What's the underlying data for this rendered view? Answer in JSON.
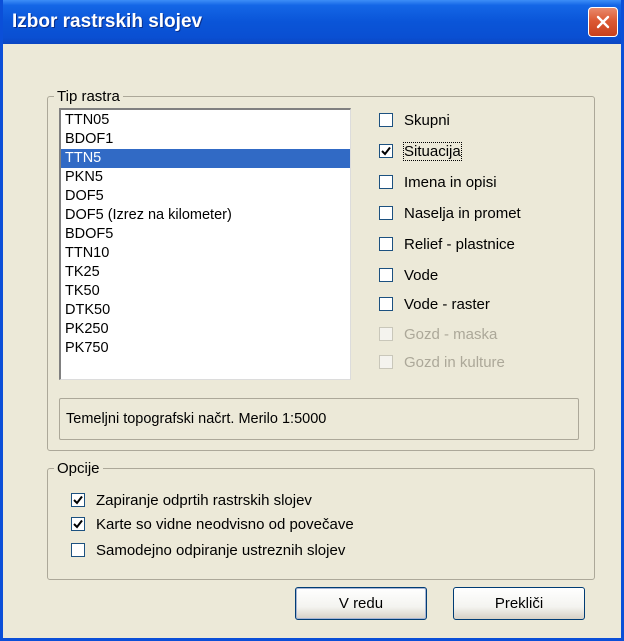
{
  "window": {
    "title": "Izbor rastrskih slojev"
  },
  "tip_rastra": {
    "legend": "Tip rastra",
    "items": [
      {
        "label": "TTN05",
        "selected": false
      },
      {
        "label": "BDOF1",
        "selected": false
      },
      {
        "label": "TTN5",
        "selected": true
      },
      {
        "label": "PKN5",
        "selected": false
      },
      {
        "label": "DOF5",
        "selected": false
      },
      {
        "label": "DOF5 (Izrez na kilometer)",
        "selected": false
      },
      {
        "label": "BDOF5",
        "selected": false
      },
      {
        "label": "TTN10",
        "selected": false
      },
      {
        "label": "TK25",
        "selected": false
      },
      {
        "label": "TK50",
        "selected": false
      },
      {
        "label": "DTK50",
        "selected": false
      },
      {
        "label": "PK250",
        "selected": false
      },
      {
        "label": "PK750",
        "selected": false
      }
    ],
    "layers": [
      {
        "label": "Skupni",
        "checked": false,
        "enabled": true
      },
      {
        "label": "Situacija",
        "checked": true,
        "enabled": true
      },
      {
        "label": "Imena in opisi",
        "checked": false,
        "enabled": true
      },
      {
        "label": "Naselja in promet",
        "checked": false,
        "enabled": true
      },
      {
        "label": "Relief - plastnice",
        "checked": false,
        "enabled": true
      },
      {
        "label": "Vode",
        "checked": false,
        "enabled": true
      },
      {
        "label": "Vode - raster",
        "checked": false,
        "enabled": true
      },
      {
        "label": "Gozd - maska",
        "checked": false,
        "enabled": false
      },
      {
        "label": "Gozd in kulture",
        "checked": false,
        "enabled": false
      }
    ],
    "description": "Temeljni topografski načrt. Merilo 1:5000"
  },
  "opcije": {
    "legend": "Opcije",
    "items": [
      {
        "label": "Zapiranje odprtih rastrskih slojev",
        "checked": true
      },
      {
        "label": "Karte so vidne neodvisno od povečave",
        "checked": true
      },
      {
        "label": "Samodejno odpiranje ustreznih slojev",
        "checked": false
      }
    ]
  },
  "buttons": {
    "ok": "V redu",
    "cancel": "Prekliči"
  },
  "colors": {
    "titlebar": "#0a55d8",
    "selection": "#316ac5",
    "close_button": "#dc5a34",
    "dialog_face": "#ece9d8"
  }
}
